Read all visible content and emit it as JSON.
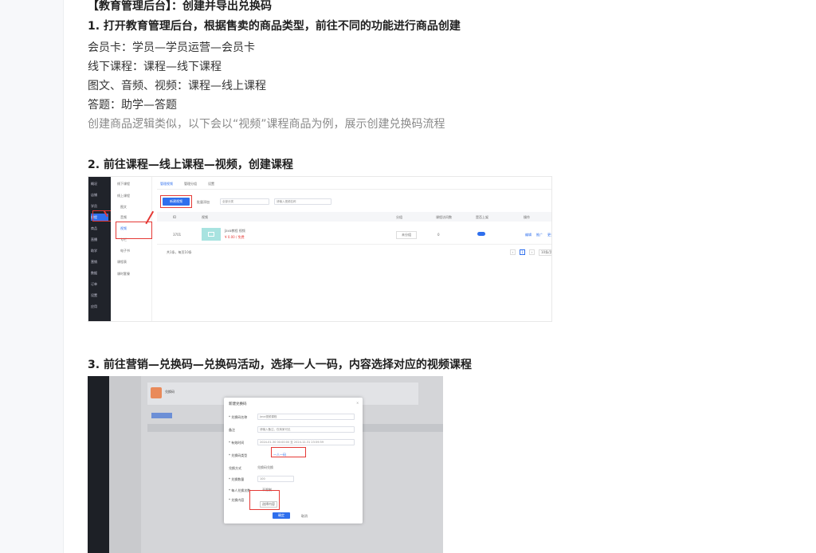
{
  "doc": {
    "title": "【教育管理后台】：创建并导出兑换码",
    "step1": "1. 打开教育管理后台，根据售卖的商品类型，前往不同的功能进行商品创建",
    "lines": [
      "会员卡：学员—学员运营—会员卡",
      "线下课程：课程—线下课程",
      "图文、音频、视频：课程—线上课程",
      "答题：助学—答题"
    ],
    "note": "创建商品逻辑类似，以下会以“视频”课程商品为例，展示创建兑换码流程",
    "step2": "2. 前往课程—线上课程—视频，创建课程",
    "step3": "3. 前往营销—兑换码—兑换码活动，选择一人一码，内容选择对应的视频课程"
  },
  "shot1": {
    "sidebar": [
      "概况",
      "店铺",
      "学员",
      "课程",
      "商品",
      "直播",
      "助学",
      "营销",
      "数据",
      "订单",
      "设置",
      "应用"
    ],
    "submenu": [
      "线下课程",
      "线上课程",
      "图文",
      "音频",
      "视频",
      "专栏",
      "电子书",
      "课程表",
      "课时套餐"
    ],
    "tabs": [
      "管理视频",
      "管理分组",
      "设置"
    ],
    "create_btn": "新建视频",
    "batch": "批量添加",
    "filter": "全部分类",
    "search_placeholder": "请输入视频名称",
    "headers": [
      "ID",
      "视频",
      "分组",
      "课程访问数",
      "是否上架",
      "操作"
    ],
    "row": {
      "id": "3701",
      "title": "Java教程 视频",
      "price": "¥ 0.00 / 免费",
      "group": "未分组",
      "count": "0",
      "actions": [
        "编辑",
        "推广",
        "更多"
      ]
    },
    "footer": "共1条，每页10条",
    "page": "1",
    "page_size": "10条/页"
  },
  "shot2": {
    "header": "兑换码",
    "modal_title": "新建兑换码",
    "fields": [
      {
        "label": "* 兑换码名称",
        "value": "Java视频课程"
      },
      {
        "label": "备注",
        "value": "请输入备注，仅商家可见"
      },
      {
        "label": "* 有效时间",
        "value": "2024-01-30 00:00:00  至  2024-12-31 23:59:59"
      },
      {
        "label": "* 兑换码类型",
        "value": "一人一码"
      },
      {
        "label": "兑换方式",
        "value": "兑换码兑换"
      },
      {
        "label": "* 兑换数量",
        "value": "100"
      },
      {
        "label": "* 每人兑换次数",
        "value": "不限制"
      },
      {
        "label": "* 兑换内容",
        "value": "选择内容"
      }
    ],
    "confirm": "确定",
    "cancel": "取消"
  }
}
